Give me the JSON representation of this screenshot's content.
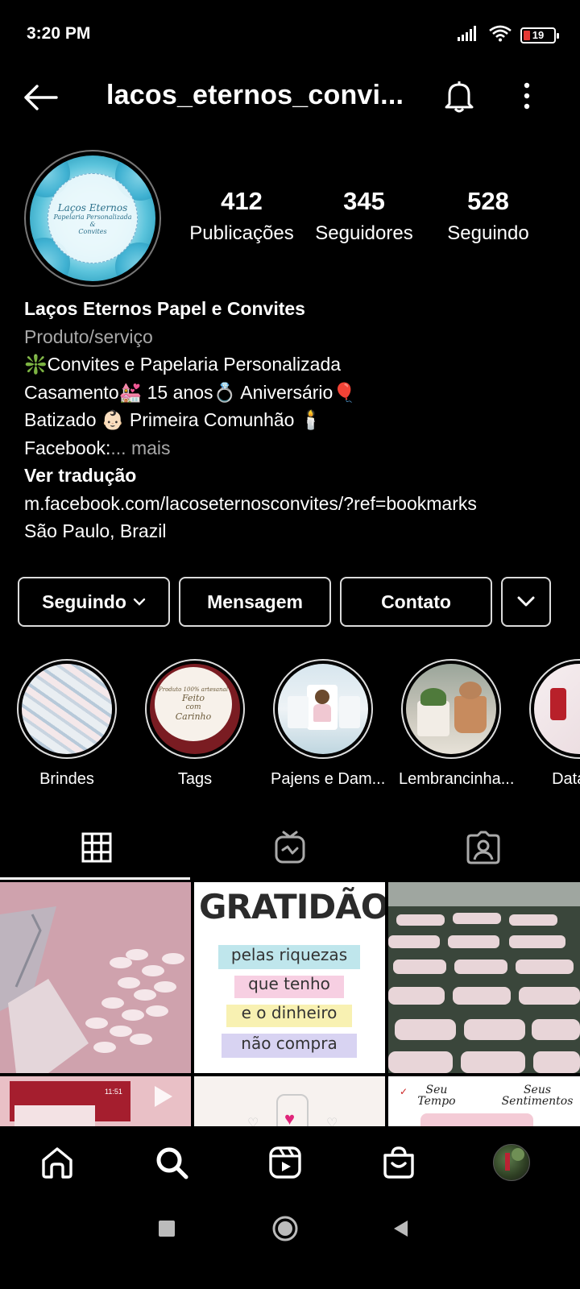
{
  "status_bar": {
    "time": "3:20 PM",
    "battery": "19",
    "battery_color": "#e53935"
  },
  "header": {
    "username": "lacos_eternos_convi...",
    "back_icon": "arrow-left-icon",
    "bell_icon": "bell-icon",
    "more_icon": "more-vertical-icon"
  },
  "profile": {
    "avatar_text": {
      "line1": "Laços Eternos",
      "line2": "Papelaria Personalizada",
      "line3": "&",
      "line4": "Convites"
    },
    "stats": [
      {
        "value": "412",
        "label": "Publicações"
      },
      {
        "value": "345",
        "label": "Seguidores"
      },
      {
        "value": "528",
        "label": "Seguindo"
      }
    ],
    "bio": {
      "name": "Laços Eternos Papel e Convites",
      "category": "Produto/serviço",
      "line1": "❇️Convites e Papelaria Personalizada",
      "line2": "Casamento💒 15 anos💍 Aniversário🎈",
      "line3": "Batizado 👶🏻 Primeira Comunhão 🕯️",
      "line4_prefix": "Facebook:",
      "line4_more": "... mais",
      "translate": "Ver tradução",
      "link": "m.facebook.com/lacoseternosconvites/?ref=bookmarks",
      "location": "São Paulo, Brazil"
    }
  },
  "actions": {
    "following_label": "Seguindo",
    "message_label": "Mensagem",
    "contact_label": "Contato"
  },
  "highlights": [
    {
      "label": "Brindes"
    },
    {
      "label": "Tags"
    },
    {
      "label": "Pajens e Dam..."
    },
    {
      "label": "Lembrancinha..."
    },
    {
      "label": "Datas c"
    }
  ],
  "highlight_tags_text": {
    "line1": "Produto 100% artesanal",
    "line2": "Feito",
    "line3": "com",
    "line4": "Carinho"
  },
  "tabs": [
    {
      "icon": "grid-icon",
      "active": true
    },
    {
      "icon": "igtv-icon",
      "active": false
    },
    {
      "icon": "tagged-user-icon",
      "active": false
    }
  ],
  "grid_posts": {
    "gratidao": {
      "title": "GRATIDÃO",
      "line1": "pelas riquezas",
      "line2": "que tenho",
      "line3": "e o dinheiro",
      "line4": "não compra"
    },
    "post6": {
      "left": "Seu Tempo",
      "right": "Seus Sentimentos"
    },
    "post4_time": "11:51"
  },
  "bottom_nav": [
    {
      "icon": "home-icon"
    },
    {
      "icon": "search-icon"
    },
    {
      "icon": "reels-icon"
    },
    {
      "icon": "shop-icon"
    },
    {
      "icon": "profile-avatar"
    }
  ],
  "system_nav": [
    {
      "icon": "recents-square-icon"
    },
    {
      "icon": "home-circle-icon"
    },
    {
      "icon": "back-triangle-icon"
    }
  ]
}
